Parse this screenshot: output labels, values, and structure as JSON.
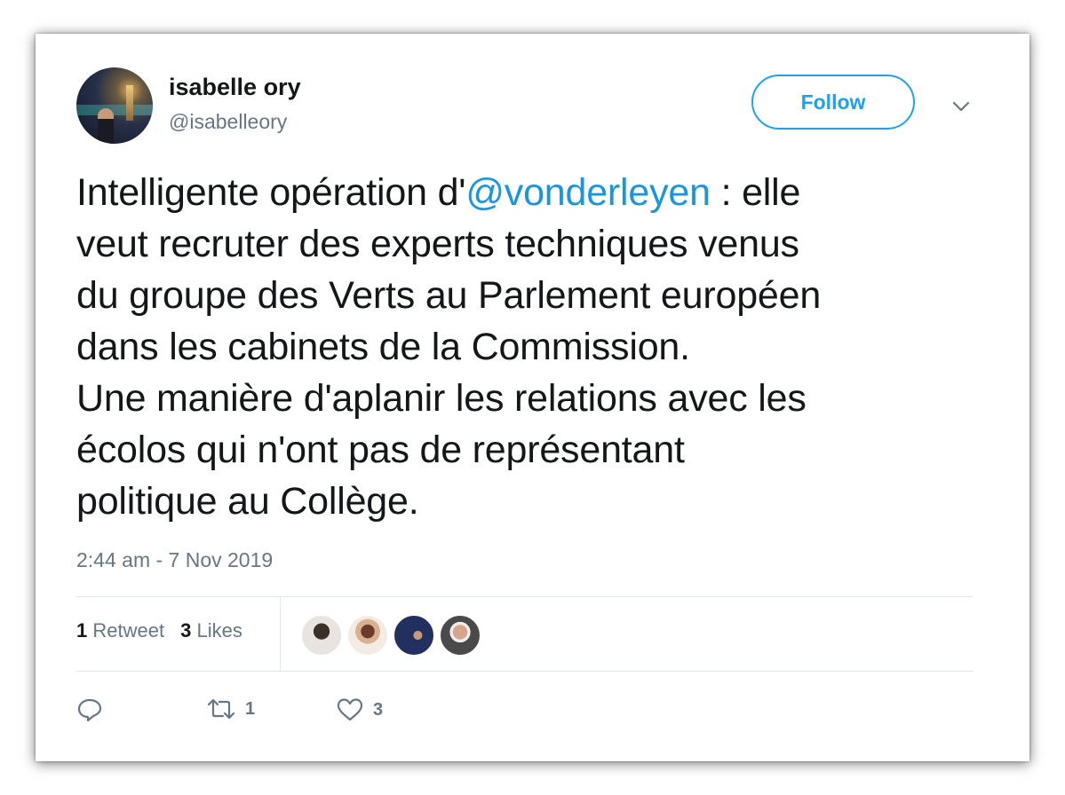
{
  "tweet": {
    "author": {
      "name": "isabelle ory",
      "handle": "@isabelleory"
    },
    "follow_label": "Follow",
    "text_lines": [
      {
        "before": "Intelligente opération d'",
        "mention": "@vonderleyen",
        "after": " : elle"
      },
      {
        "text": "veut recruter des experts techniques venus"
      },
      {
        "text": "du groupe des Verts au Parlement européen"
      },
      {
        "text": "dans les cabinets de la Commission."
      },
      {
        "text": "Une manière d'aplanir les relations avec les"
      },
      {
        "text": "écolos qui n'ont pas de représentant"
      },
      {
        "text": "politique au Collège."
      }
    ],
    "timestamp": "2:44 am - 7 Nov 2019",
    "stats": {
      "retweet_count": "1",
      "retweet_label": "Retweet",
      "like_count": "3",
      "like_label": "Likes"
    },
    "actions": {
      "reply_icon": "reply-icon",
      "retweet_icon": "retweet-icon",
      "retweet_count": "1",
      "like_icon": "heart-icon",
      "like_count": "3"
    }
  },
  "colors": {
    "accent": "#1da1f2",
    "mention": "#1b95e0",
    "text": "#14171a",
    "muted": "#657786",
    "divider": "#e1e8ed"
  }
}
